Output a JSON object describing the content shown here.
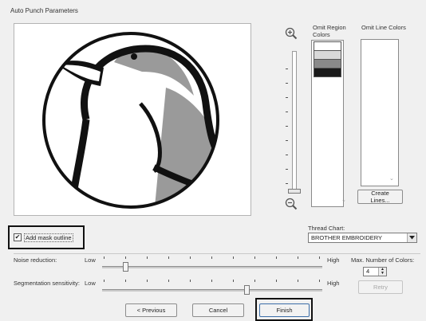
{
  "window": {
    "title": "Auto Punch Parameters"
  },
  "omit_region": {
    "label_line1": "Omit Region",
    "label_line2": "Colors"
  },
  "omit_line": {
    "label": "Omit Line Colors"
  },
  "buttons": {
    "create_lines": "Create Lines...",
    "retry": "Retry",
    "previous": "< Previous",
    "cancel": "Cancel",
    "finish": "Finish"
  },
  "thread_chart": {
    "label": "Thread Chart:",
    "value": "BROTHER EMBROIDERY"
  },
  "mask_outline": {
    "label": "Add mask outline",
    "checked": true
  },
  "noise": {
    "label": "Noise reduction:",
    "low": "Low",
    "high": "High"
  },
  "segmentation": {
    "label": "Segmentation sensitivity:",
    "low": "Low",
    "high": "High"
  },
  "max_colors": {
    "label": "Max. Number of Colors:",
    "value": "4"
  },
  "icons": {
    "zoom_in": "zoom-in-icon",
    "zoom_out": "zoom-out-icon"
  },
  "colors": {
    "region_swatches": [
      "#ffffff",
      "#d9d9d9",
      "#8a8a8a",
      "#1a1a1a"
    ],
    "penguin_gray": "#9a9a9a",
    "penguin_dark": "#111111"
  }
}
